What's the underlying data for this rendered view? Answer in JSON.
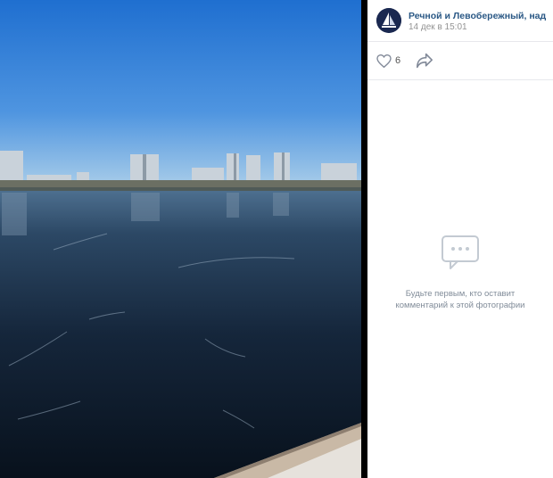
{
  "post": {
    "author": "Речной и Левобережный, надень ...",
    "date": "14 дек в 15:01",
    "avatar_icon": "sailboat-logo",
    "likes": "6"
  },
  "comments": {
    "empty_line1": "Будьте первым, кто оставит",
    "empty_line2": "комментарий к этой фотографии",
    "icon": "comments-bubble-icon"
  },
  "photo": {
    "description_icon": "photo-frozen-river-city"
  },
  "colors": {
    "link": "#2a5885",
    "muted": "#939393",
    "sky": "#2f7fd6",
    "ice": "#0e1c2e"
  }
}
